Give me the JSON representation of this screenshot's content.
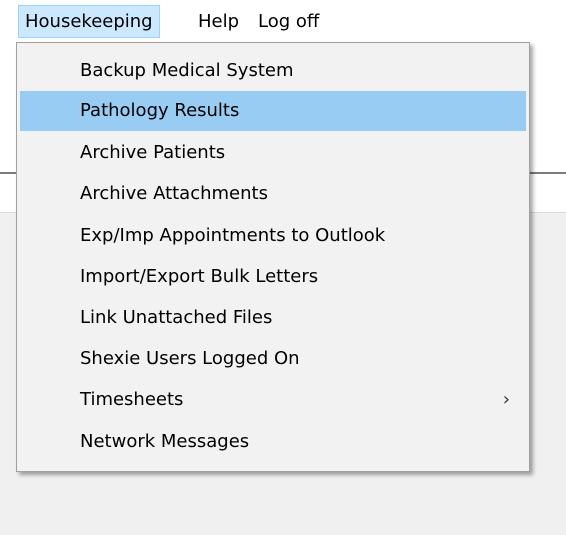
{
  "menubar": {
    "items": [
      {
        "label": "Housekeeping"
      },
      {
        "label": "Help"
      },
      {
        "label": "Log off"
      }
    ]
  },
  "dropdown": {
    "items": [
      {
        "label": "Backup Medical System"
      },
      {
        "label": "Pathology Results"
      },
      {
        "label": "Archive Patients"
      },
      {
        "label": "Archive Attachments"
      },
      {
        "label": "Exp/Imp Appointments to Outlook"
      },
      {
        "label": "Import/Export Bulk Letters"
      },
      {
        "label": "Link Unattached Files"
      },
      {
        "label": "Shexie Users Logged On"
      },
      {
        "label": "Timesheets",
        "submenu_icon": "chevron-right-icon",
        "submenu_glyph": "›"
      },
      {
        "label": "Network Messages"
      }
    ],
    "highlighted_label": "Pathology Results"
  },
  "colors": {
    "menubar_active_bg": "#cce8ff",
    "menubar_active_border": "#99d1ff",
    "menu_highlight": "#99ccf3",
    "menu_bg": "#f2f2f2"
  }
}
